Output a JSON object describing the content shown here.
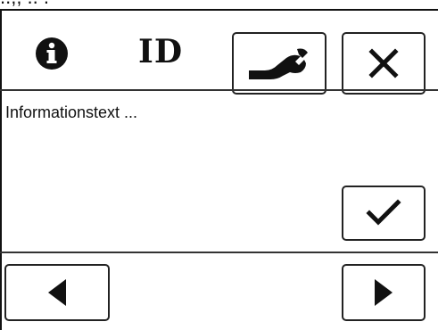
{
  "caption": "..,,    ..    .",
  "header": {
    "info_icon": "info-icon",
    "id_label": "ID",
    "settings_icon": "wrench-icon",
    "close_icon": "close-icon"
  },
  "content": {
    "text": "Informationstext ...",
    "confirm_icon": "checkmark-icon"
  },
  "footer": {
    "prev_icon": "triangle-left-icon",
    "next_icon": "triangle-right-icon"
  },
  "colors": {
    "foreground": "#111111",
    "background": "#ffffff"
  }
}
